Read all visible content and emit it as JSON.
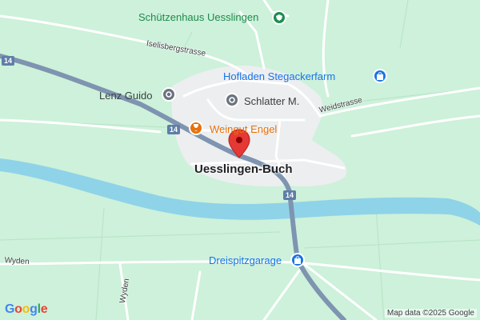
{
  "map": {
    "places": {
      "town": "Uesslingen-Buch"
    },
    "pois": {
      "schuetzenhaus": "Schützenhaus Uesslingen",
      "hofladen": "Hofladen Stegackerfarm",
      "lenz": "Lenz Guido",
      "schlatter": "Schlatter M.",
      "weingut": "Weingut Engel",
      "dreispitz": "Dreispitzgarage"
    },
    "streets": {
      "iselisberg": "Iselisbergstrasse",
      "weid": "Weidstrasse",
      "wyden1": "Wyden",
      "wyden2": "Wyden"
    },
    "road_shields": [
      "14",
      "14",
      "14"
    ],
    "attribution": "Map data ©2025 Google",
    "logo": {
      "letters": [
        "G",
        "o",
        "o",
        "g",
        "l",
        "e"
      ],
      "colors": [
        "#4285f4",
        "#ea4335",
        "#fbbc05",
        "#4285f4",
        "#34a853",
        "#ea4335"
      ]
    },
    "colors": {
      "land": "#cdf1da",
      "water": "#8fd3e8",
      "urban": "#eceeef",
      "highway": "#7e94b0",
      "pin": "#e53935"
    },
    "icons": {
      "schuetzenhaus": "shield-poi-icon",
      "hofladen": "shopping-bag-icon",
      "lenz": "generic-poi-icon",
      "schlatter": "generic-poi-icon",
      "weingut": "wine-glass-icon",
      "dreispitz": "shopping-bag-icon",
      "pin": "location-pin-icon"
    }
  }
}
